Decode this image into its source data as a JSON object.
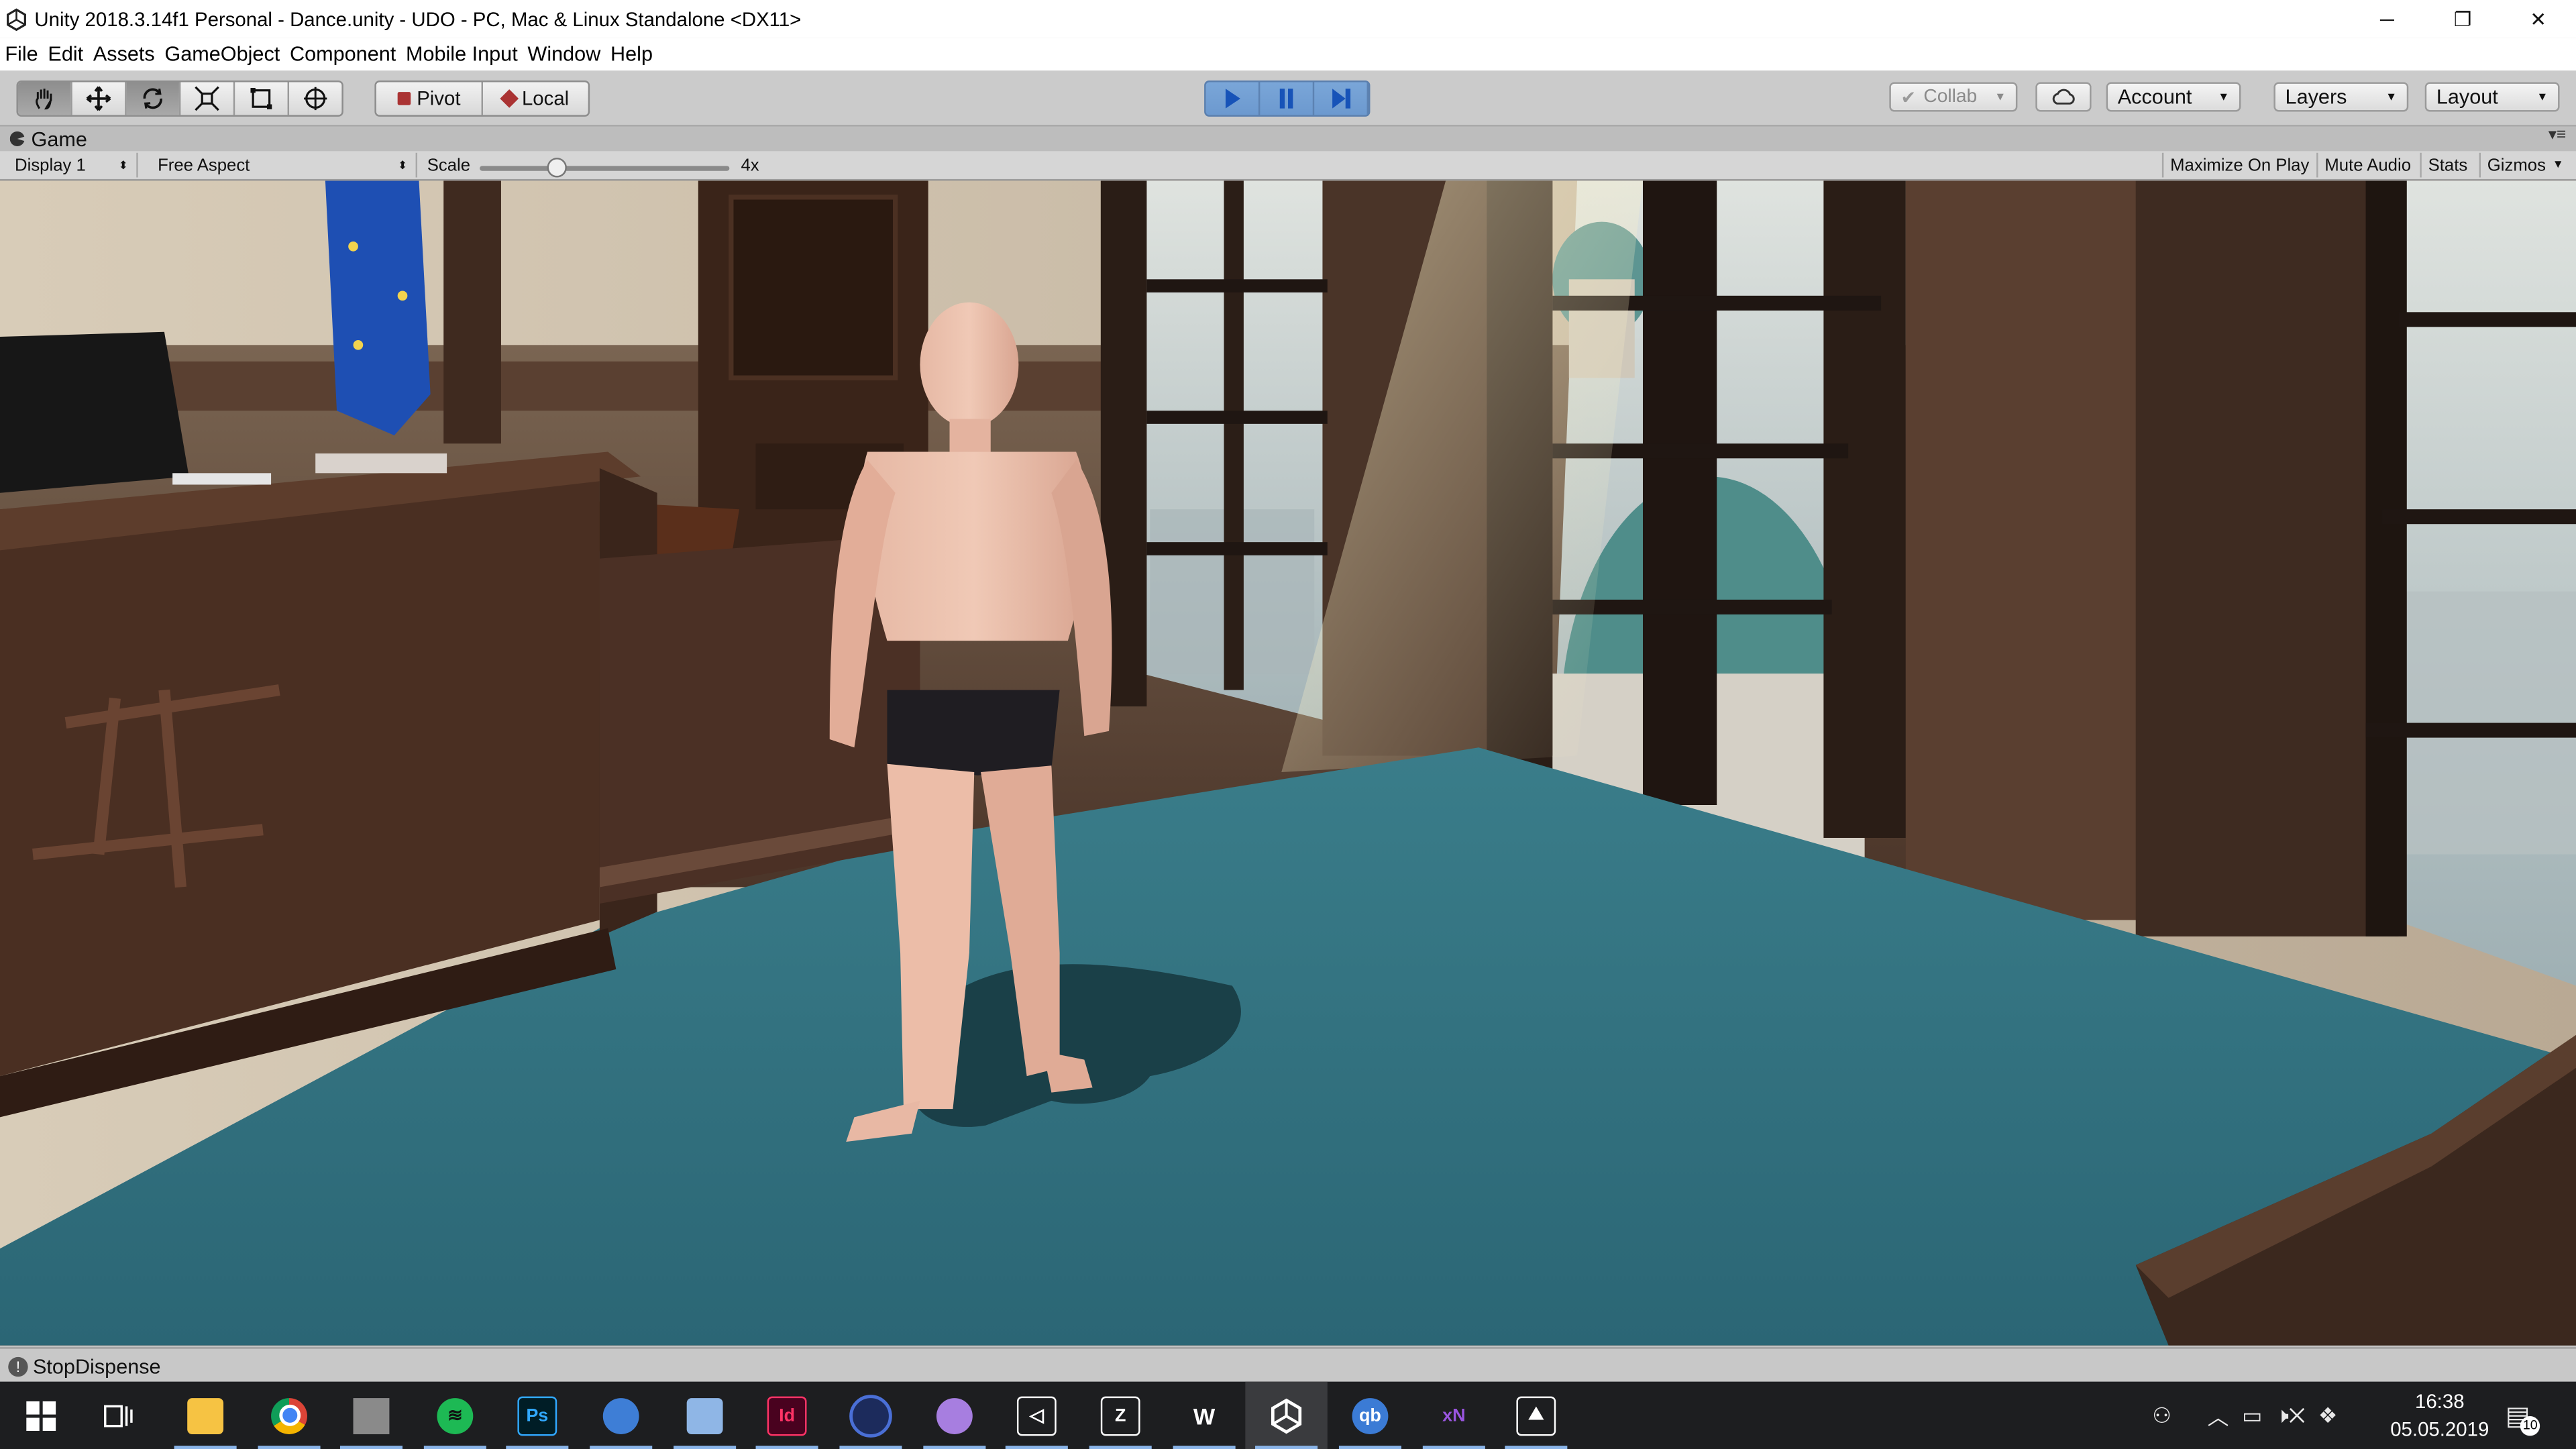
{
  "window": {
    "title": "Unity 2018.3.14f1 Personal - Dance.unity - UDO - PC, Mac & Linux Standalone <DX11>",
    "minimize": "─",
    "restore": "❐",
    "close": "✕"
  },
  "menu": [
    "File",
    "Edit",
    "Assets",
    "GameObject",
    "Component",
    "Mobile Input",
    "Window",
    "Help"
  ],
  "toolbar": {
    "tools": [
      "hand-tool",
      "move-tool",
      "rotate-tool",
      "scale-tool",
      "rect-tool",
      "transform-tool"
    ],
    "pivot_label": "Pivot",
    "local_label": "Local",
    "play_buttons": [
      "play",
      "pause",
      "step"
    ],
    "collab_label": "Collab",
    "account_label": "Account",
    "layers_label": "Layers",
    "layout_label": "Layout"
  },
  "game_tab": {
    "tab_label": "Game",
    "display_label": "Display 1",
    "aspect_label": "Free Aspect",
    "scale_label": "Scale",
    "scale_value": "4x",
    "maximize_label": "Maximize On Play",
    "mute_label": "Mute Audio",
    "stats_label": "Stats",
    "gizmos_label": "Gizmos"
  },
  "status": {
    "message": "StopDispense"
  },
  "taskbar": {
    "apps": [
      {
        "name": "start-icon",
        "color": "#ffffff"
      },
      {
        "name": "task-view-icon",
        "color": "#ffffff"
      },
      {
        "name": "file-explorer-icon",
        "color": "#f6c343"
      },
      {
        "name": "chrome-icon",
        "color": "#dd4b39"
      },
      {
        "name": "blank-app-icon",
        "color": "#8a8a8a"
      },
      {
        "name": "spotify-icon",
        "color": "#1db954"
      },
      {
        "name": "photoshop-icon",
        "color": "#31a8ff",
        "text": "Ps"
      },
      {
        "name": "thunderbird-icon",
        "color": "#3e7ed6"
      },
      {
        "name": "network-app-icon",
        "color": "#8fb6e6"
      },
      {
        "name": "indesign-icon",
        "color": "#ff3366",
        "text": "Id"
      },
      {
        "name": "cinema4d-icon",
        "color": "#4a6fd6"
      },
      {
        "name": "github-icon",
        "color": "#a77ee0"
      },
      {
        "name": "unity-hub-icon",
        "color": "#ffffff"
      },
      {
        "name": "zbrush-icon",
        "color": "#ffffff"
      },
      {
        "name": "wacom-icon",
        "color": "#ffffff",
        "text": "W"
      },
      {
        "name": "unity-icon",
        "color": "#ffffff"
      },
      {
        "name": "qbittorrent-icon",
        "color": "#3b7bd5",
        "text": "qb"
      },
      {
        "name": "xnormal-icon",
        "color": "#9a55e0",
        "text": "xN"
      },
      {
        "name": "photos-icon",
        "color": "#ffffff"
      }
    ],
    "clock_time": "16:38",
    "clock_date": "05.05.2019",
    "notification_count": "10"
  }
}
